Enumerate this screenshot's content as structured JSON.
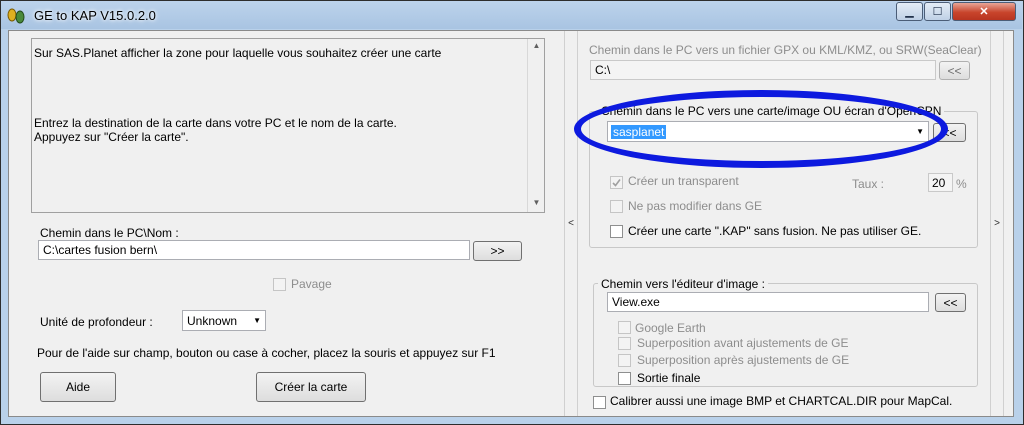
{
  "window": {
    "title": "GE to KAP V15.0.2.0",
    "minimize": "▁",
    "maximize": "☐",
    "close": "✕"
  },
  "left": {
    "info_line1": "Sur SAS.Planet  afficher la zone pour laquelle vous souhaitez créer une carte",
    "info_line2": "Entrez la destination de la carte dans votre PC et le nom de la carte.",
    "info_line3": "Appuyez sur \"Créer la carte\".",
    "path_label": "Chemin dans le PC\\Nom :",
    "path_value": "C:\\cartes fusion bern\\",
    "browse_button": ">>",
    "pavage_label": "Pavage",
    "depth_label": "Unité de profondeur :",
    "depth_value": "Unknown",
    "help_text": "Pour de l'aide sur champ, bouton ou case à cocher, placez la souris et appuyez sur F1",
    "help_button": "Aide",
    "create_button": "Créer la carte"
  },
  "splitter": {
    "left_arrow": "<",
    "right_arrow": ">"
  },
  "right": {
    "gpx_label": "Chemin dans le PC vers un fichier GPX ou KML/KMZ, ou SRW(SeaClear)",
    "gpx_value": "C:\\",
    "gpx_button": "<<",
    "map_group_label": "Chemin dans le PC vers une carte/image OU écran d'OpenCPN",
    "map_value": "sasplanet",
    "map_button": "<<",
    "transparent_label": "Créer un transparent",
    "taux_label": "Taux :",
    "taux_value": "20",
    "taux_unit": "%",
    "no_modify_label": "Ne pas modifier dans GE",
    "kap_no_fusion_label": "Créer une carte \".KAP\" sans fusion. Ne pas utiliser GE.",
    "editor_group_label": "Chemin vers l'éditeur d'image :",
    "editor_value": "View.exe",
    "editor_button": "<<",
    "opt_google_earth": "Google Earth",
    "opt_before": "Superposition avant ajustements de GE",
    "opt_after": "Superposition après ajustements de GE",
    "opt_final": "Sortie finale",
    "calibrate_label": "Calibrer aussi une image BMP et CHARTCAL.DIR pour MapCal."
  }
}
